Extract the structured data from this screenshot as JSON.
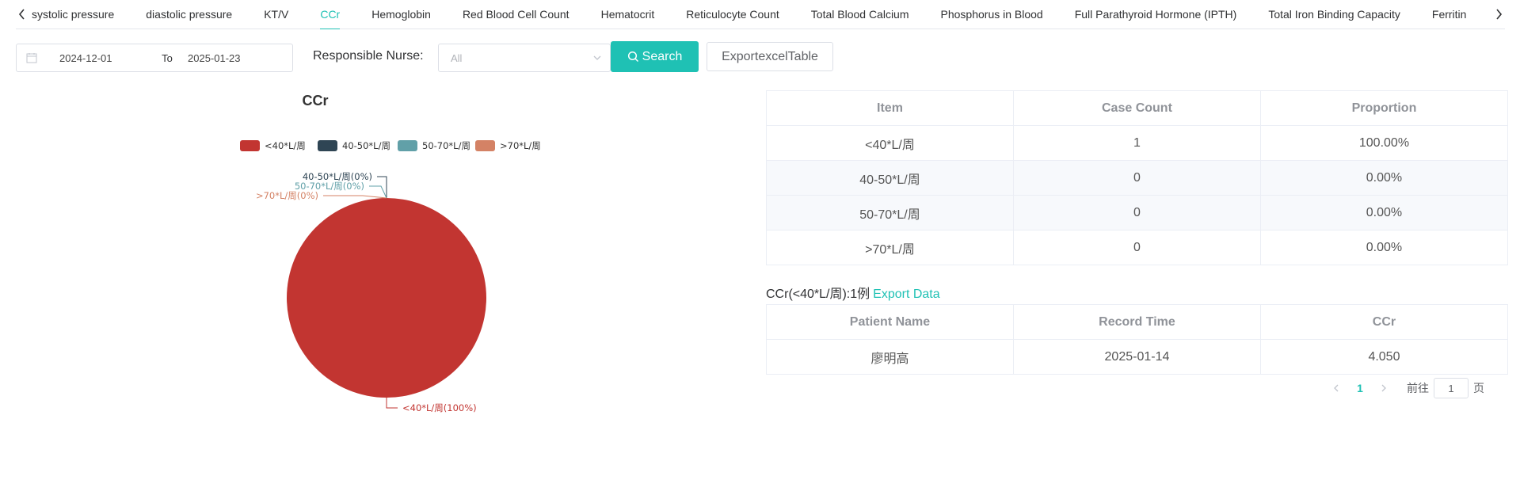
{
  "tabs": {
    "items": [
      "systolic pressure",
      "diastolic pressure",
      "KT/V",
      "CCr",
      "Hemoglobin",
      "Red Blood Cell Count",
      "Hematocrit",
      "Reticulocyte Count",
      "Total Blood Calcium",
      "Phosphorus in Blood",
      "Full Parathyroid Hormone (IPTH)",
      "Total Iron Binding Capacity",
      "Ferritin"
    ],
    "active": "CCr"
  },
  "filter": {
    "date_start": "2024-12-01",
    "date_separator": "To",
    "date_end": "2025-01-23",
    "nurse_label": "Responsible Nurse:",
    "nurse_value": "All",
    "search_label": "Search",
    "export_label": "ExportexcelTable"
  },
  "colors": {
    "accent": "#1fc1b4",
    "series": [
      "#c23531",
      "#2f4554",
      "#61a0a8",
      "#d48265"
    ]
  },
  "chart_data": {
    "type": "pie",
    "title": "CCr",
    "legend_position": "top-center",
    "categories": [
      "<40*L/周",
      "40-50*L/周",
      "50-70*L/周",
      ">70*L/周"
    ],
    "values": [
      1,
      0,
      0,
      0
    ],
    "labels": [
      "<40*L/周(100%)",
      "40-50*L/周(0%)",
      "50-70*L/周(0%)",
      ">70*L/周(0%)"
    ]
  },
  "summary_table": {
    "headers": [
      "Item",
      "Case Count",
      "Proportion"
    ],
    "rows": [
      [
        "<40*L/周",
        "1",
        "100.00%"
      ],
      [
        "40-50*L/周",
        "0",
        "0.00%"
      ],
      [
        "50-70*L/周",
        "0",
        "0.00%"
      ],
      [
        ">70*L/周",
        "0",
        "0.00%"
      ]
    ]
  },
  "detail": {
    "title": "CCr(<40*L/周):1例",
    "export_link": "Export Data",
    "headers": [
      "Patient Name",
      "Record Time",
      "CCr"
    ],
    "rows": [
      [
        "廖明高",
        "2025-01-14",
        "4.050"
      ]
    ]
  },
  "pagination": {
    "current_page": "1",
    "goto_label": "前往",
    "goto_value": "1",
    "page_suffix": "页"
  }
}
